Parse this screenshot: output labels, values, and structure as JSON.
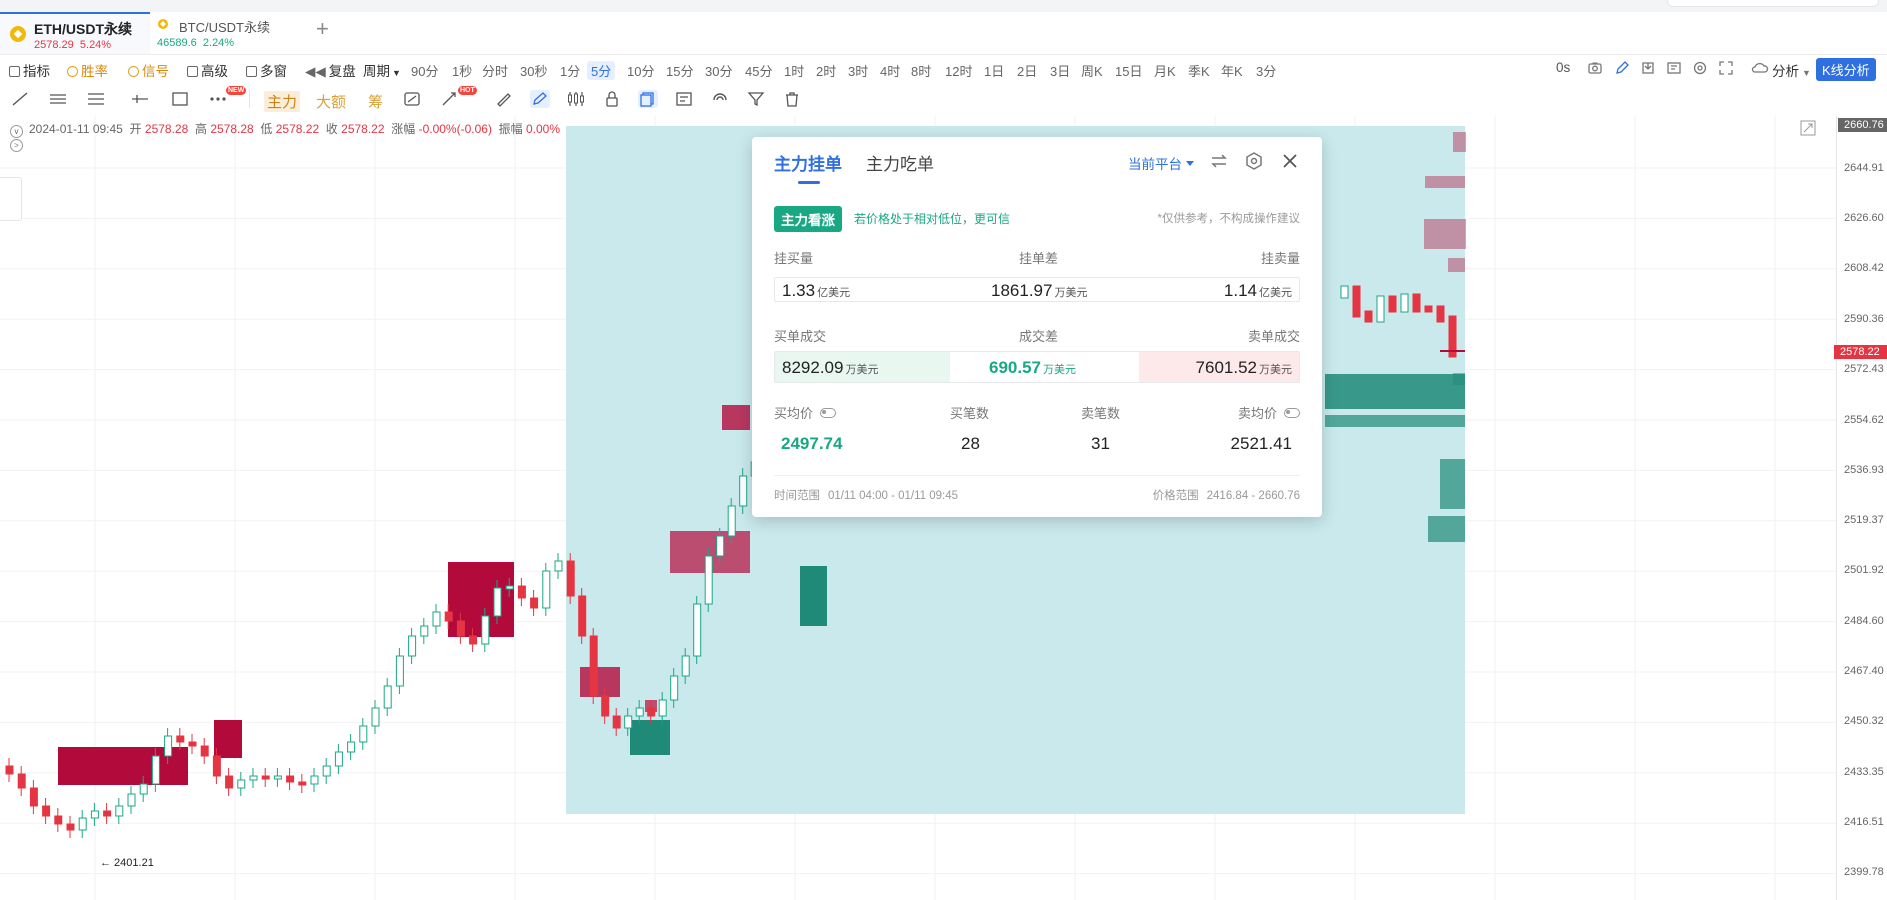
{
  "tabs": [
    {
      "name": "ETH/USDT永续",
      "price": "2578.29",
      "change": "5.24%",
      "trend": "down"
    },
    {
      "name": "BTC/USDT永续",
      "price": "46589.6",
      "change": "2.24%",
      "trend": "up"
    }
  ],
  "toolbar1": {
    "items": [
      "指标",
      "胜率",
      "信号",
      "高级",
      "多窗",
      "复盘",
      "周期"
    ],
    "periods": [
      "90分",
      "1秒",
      "分时",
      "30秒",
      "1分",
      "5分",
      "10分",
      "15分",
      "30分",
      "45分",
      "1时",
      "2时",
      "3时",
      "4时",
      "8时",
      "12时",
      "1日",
      "2日",
      "3日",
      "周K",
      "15日",
      "月K",
      "季K",
      "年K",
      "3分"
    ],
    "active_period": "5分",
    "right_time": "0s",
    "analysis": "分析",
    "kline_button": "K线分析"
  },
  "toolbar2": {
    "labels": [
      "主力",
      "大额",
      "筹"
    ],
    "badges": {
      "new": "NEW",
      "hot": "HOT"
    }
  },
  "info": {
    "datetime": "2024-01-11 09:45",
    "open_label": "开",
    "open": "2578.28",
    "high_label": "高",
    "high": "2578.28",
    "low_label": "低",
    "low": "2578.22",
    "close_label": "收",
    "close": "2578.22",
    "change_label": "涨幅",
    "change": "-0.00%(-0.06)",
    "amp_label": "振幅",
    "amp": "0.00%"
  },
  "axis": {
    "max_label": "2660.76",
    "current_price": "2578.22",
    "ticks": [
      "2644.91",
      "2626.60",
      "2608.42",
      "2590.36",
      "2572.43",
      "2554.62",
      "2536.93",
      "2519.37",
      "2501.92",
      "2484.60",
      "2467.40",
      "2450.32",
      "2433.35",
      "2416.51",
      "2399.78"
    ]
  },
  "chart": {
    "low_marker": "← 2401.21",
    "colors": {
      "up": "#1aa784",
      "down": "#e53542",
      "highlight": "#c9e9ec",
      "buy_block": "#b30a3c",
      "sell_block": "#1f8a78"
    }
  },
  "popup": {
    "tab_active": "主力挂单",
    "tab_other": "主力吃单",
    "platform": "当前平台",
    "signal": "主力看涨",
    "signal_note": "若价格处于相对低位，更可信",
    "disclaimer": "*仅供参考，不构成操作建议",
    "row1_headers": [
      "挂买量",
      "挂单差",
      "挂卖量"
    ],
    "bid_volume": "1.33",
    "bid_unit": "亿美元",
    "order_diff": "1861.97",
    "order_diff_unit": "万美元",
    "ask_volume": "1.14",
    "ask_unit": "亿美元",
    "row2_headers": [
      "买单成交",
      "成交差",
      "卖单成交"
    ],
    "buy_deal": "8292.09",
    "buy_deal_unit": "万美元",
    "deal_diff": "690.57",
    "deal_diff_unit": "万美元",
    "sell_deal": "7601.52",
    "sell_deal_unit": "万美元",
    "row3_headers": [
      "买均价",
      "买笔数",
      "卖笔数",
      "卖均价"
    ],
    "buy_avg": "2497.74",
    "buy_count": "28",
    "sell_count": "31",
    "sell_avg": "2521.41",
    "time_range_label": "时间范围",
    "time_range": "01/11 04:00 - 01/11 09:45",
    "price_range_label": "价格范围",
    "price_range": "2416.84 - 2660.76"
  }
}
